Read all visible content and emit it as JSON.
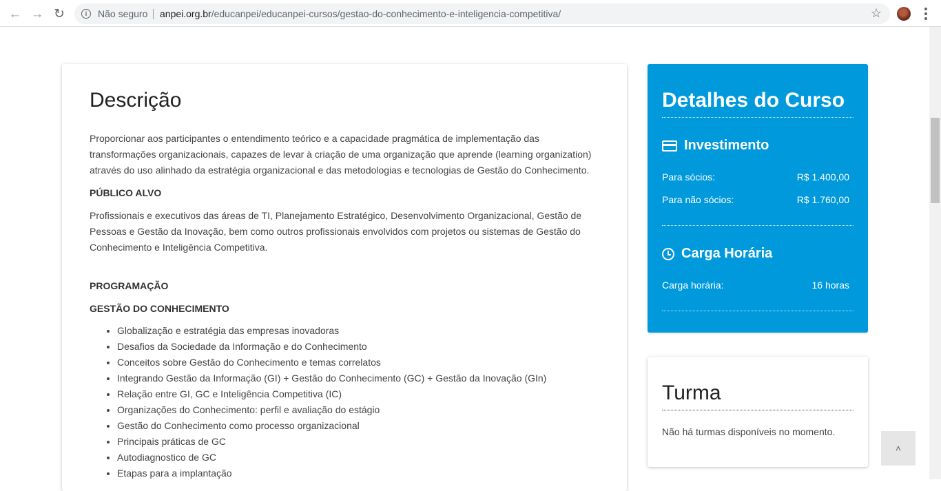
{
  "browser": {
    "security_label": "Não seguro",
    "url_host": "anpei.org.br",
    "url_path": "/educanpei/educanpei-cursos/gestao-do-conhecimento-e-inteligencia-competitiva/"
  },
  "description": {
    "title": "Descrição",
    "intro": "Proporcionar aos participantes o entendimento teórico e a capacidade pragmática de implementação das transformações organizacionais, capazes de levar à criação de uma organização que aprende (learning organization) através do uso alinhado da estratégia organizacional e das metodologias e tecnologias de Gestão do Conhecimento.",
    "audience_label": "PÚBLICO ALVO",
    "audience_text": "Profissionais e executivos das áreas de TI, Planejamento Estratégico, Desenvolvimento Organizacional, Gestão de Pessoas e Gestão da Inovação, bem como outros profissionais envolvidos com projetos ou sistemas de Gestão do Conhecimento e Inteligência Competitiva.",
    "program_label": "PROGRAMAÇÃO",
    "module_label": "GESTÃO DO CONHECIMENTO",
    "program_items": [
      "Globalização e estratégia das empresas inovadoras",
      "Desafios da Sociedade da Informação e do Conhecimento",
      "Conceitos sobre Gestão do Conhecimento e temas correlatos",
      "Integrando Gestão da Informação (GI) + Gestão do Conhecimento (GC) + Gestão da Inovação (GIn)",
      "Relação entre GI, GC e Inteligência Competitiva (IC)",
      "Organizações do Conhecimento: perfil e avaliação do estágio",
      "Gestão do Conhecimento como processo organizacional",
      "Principais práticas de GC",
      "Autodiagnostico de GC",
      "Etapas para a implantação"
    ]
  },
  "details": {
    "title": "Detalhes do Curso",
    "investment_heading": "Investimento",
    "members_label": "Para sócios:",
    "members_price": "R$ 1.400,00",
    "non_members_label": "Para não sócios:",
    "non_members_price": "R$ 1.760,00",
    "workload_heading": "Carga Horária",
    "workload_label": "Carga horária:",
    "workload_value": "16 horas",
    "accent_color": "#0099dc"
  },
  "turma": {
    "title": "Turma",
    "message": "Não há turmas disponíveis no momento."
  },
  "back_to_top": {
    "glyph": "˄"
  }
}
